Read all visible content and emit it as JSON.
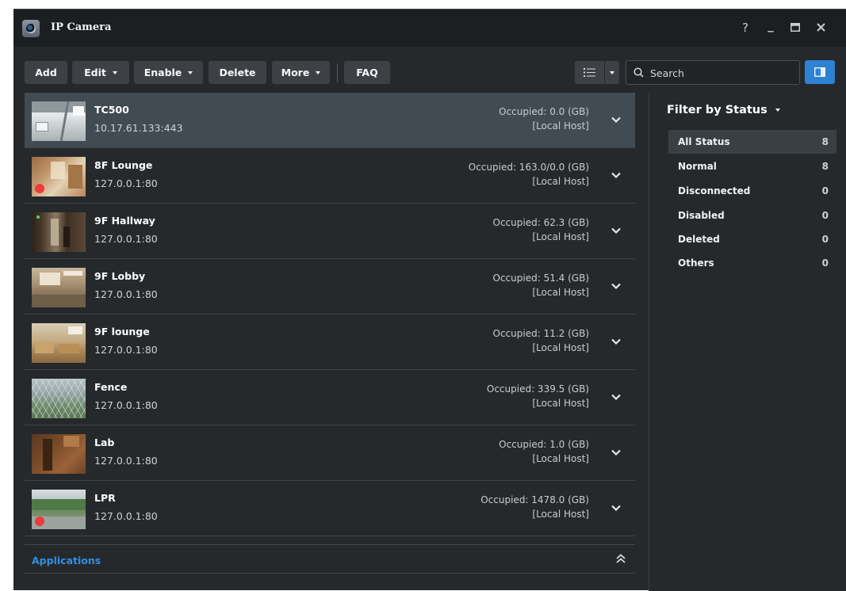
{
  "window": {
    "title": "IP Camera",
    "controls": {
      "help": "?",
      "minimize": "_",
      "maximize": "▣",
      "close": "✕"
    }
  },
  "toolbar": {
    "add": "Add",
    "edit": "Edit",
    "enable": "Enable",
    "delete": "Delete",
    "more": "More",
    "faq": "FAQ"
  },
  "search": {
    "placeholder": "Search"
  },
  "cameras": [
    {
      "name": "TC500",
      "address": "10.17.61.133:443",
      "occupied": "Occupied: 0.0 (GB)",
      "host": "[Local Host]",
      "recording": false,
      "selected": true
    },
    {
      "name": "8F Lounge",
      "address": "127.0.0.1:80",
      "occupied": "Occupied: 163.0/0.0 (GB)",
      "host": "[Local Host]",
      "recording": true,
      "selected": false
    },
    {
      "name": "9F Hallway",
      "address": "127.0.0.1:80",
      "occupied": "Occupied: 62.3 (GB)",
      "host": "[Local Host]",
      "recording": false,
      "selected": false
    },
    {
      "name": "9F Lobby",
      "address": "127.0.0.1:80",
      "occupied": "Occupied: 51.4 (GB)",
      "host": "[Local Host]",
      "recording": false,
      "selected": false
    },
    {
      "name": "9F lounge",
      "address": "127.0.0.1:80",
      "occupied": "Occupied: 11.2 (GB)",
      "host": "[Local Host]",
      "recording": false,
      "selected": false
    },
    {
      "name": "Fence",
      "address": "127.0.0.1:80",
      "occupied": "Occupied: 339.5 (GB)",
      "host": "[Local Host]",
      "recording": false,
      "selected": false
    },
    {
      "name": "Lab",
      "address": "127.0.0.1:80",
      "occupied": "Occupied: 1.0 (GB)",
      "host": "[Local Host]",
      "recording": false,
      "selected": false
    },
    {
      "name": "LPR",
      "address": "127.0.0.1:80",
      "occupied": "Occupied: 1478.0 (GB)",
      "host": "[Local Host]",
      "recording": true,
      "selected": false
    }
  ],
  "applications": {
    "label": "Applications"
  },
  "filter": {
    "title": "Filter by Status",
    "items": [
      {
        "label": "All Status",
        "count": "8",
        "active": true
      },
      {
        "label": "Normal",
        "count": "8",
        "active": false
      },
      {
        "label": "Disconnected",
        "count": "0",
        "active": false
      },
      {
        "label": "Disabled",
        "count": "0",
        "active": false
      },
      {
        "label": "Deleted",
        "count": "0",
        "active": false
      },
      {
        "label": "Others",
        "count": "0",
        "active": false
      }
    ]
  },
  "colors": {
    "accent": "#2d82d4",
    "link": "#2f8fe6",
    "recording": "#ee3b3b",
    "selected_row": "#424a52"
  }
}
